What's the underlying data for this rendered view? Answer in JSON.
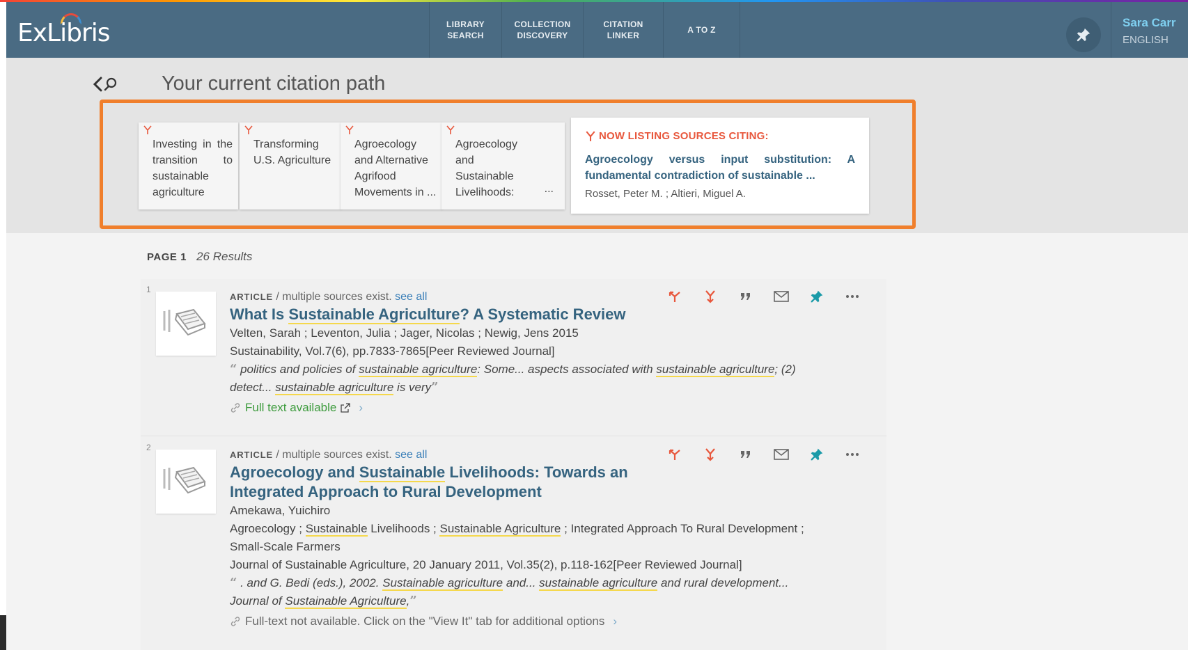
{
  "brand": {
    "logo_text": "ExLibris"
  },
  "nav": {
    "items": [
      {
        "line1": "LIBRARY",
        "line2": "SEARCH"
      },
      {
        "line1": "COLLECTION",
        "line2": "DISCOVERY"
      },
      {
        "line1": "CITATION",
        "line2": "LINKER"
      },
      {
        "line1": "A TO Z",
        "line2": ""
      }
    ]
  },
  "user": {
    "name": "Sara Carr",
    "language": "ENGLISH"
  },
  "citation_path": {
    "title": "Your current citation path",
    "cards": [
      {
        "text": "Investing in the transition to sustainable agriculture"
      },
      {
        "text": "Transforming U.S. Agriculture"
      },
      {
        "text": "Agroecology and Alternative Agrifood Movements in ..."
      },
      {
        "text": "Agroecology and Sustainable Livelihoods:"
      }
    ],
    "card4_ellipsis": "...",
    "now_listing": {
      "heading": "NOW LISTING SOURCES CITING:",
      "title": "Agroecology versus input substitution: A fundamental contradiction of sustainable ...",
      "authors": "Rosset, Peter M. ; Altieri, Miguel A."
    }
  },
  "results_header": {
    "page_label": "PAGE 1",
    "count": "26 Results"
  },
  "results": [
    {
      "number": "1",
      "type": "ARTICLE",
      "multi": "/ multiple sources exist.",
      "see_all": "see all",
      "title_pre": "What Is ",
      "title_hl": "Sustainable Agriculture",
      "title_post": "? A Systematic Review",
      "authors": "Velten, Sarah ; Leventon, Julia ; Jager, Nicolas ; Newig, Jens 2015",
      "source": "Sustainability, Vol.7(6), pp.7833-7865[Peer Reviewed Journal]",
      "snippet": {
        "a": " politics and policies of ",
        "b": "sustainable agriculture",
        "c": ": Some... aspects associated with ",
        "d": "sustainable agriculture",
        "e": "; (2) detect... ",
        "f": "sustainable agriculture",
        "g": " is very"
      },
      "availability": "Full text available"
    },
    {
      "number": "2",
      "type": "ARTICLE",
      "multi": "/ multiple sources exist.",
      "see_all": "see all",
      "title_pre": "Agroecology and ",
      "title_hl": "Sustainable",
      "title_post": " Livelihoods: Towards an Integrated Approach to Rural Development",
      "authors": "Amekawa, Yuichiro",
      "subjects": {
        "a": "Agroecology ; ",
        "b": "Sustainable",
        "c": " Livelihoods ; ",
        "d": "Sustainable Agriculture",
        "e": " ; Integrated Approach To Rural Development ; Small-Scale Farmers"
      },
      "source": "Journal of Sustainable Agriculture, 20 January 2011, Vol.35(2), p.118-162[Peer Reviewed Journal]",
      "snippet": {
        "a": " . and G. Bedi (eds.), 2002. ",
        "b": "Sustainable agriculture",
        "c": " and... ",
        "d": "sustainable agriculture",
        "e": " and rural development... Journal of ",
        "f": "Sustainable Agriculture",
        "g": ","
      },
      "availability": "Full-text not available. Click on the \"View It\" tab for additional options"
    }
  ],
  "colors": {
    "topbar": "#4a6b83",
    "accent_orange": "#f07f2c",
    "cite_red": "#e8573c",
    "title_blue": "#35637f",
    "available_green": "#3d9b3d",
    "pin_teal": "#1a9aa8"
  }
}
